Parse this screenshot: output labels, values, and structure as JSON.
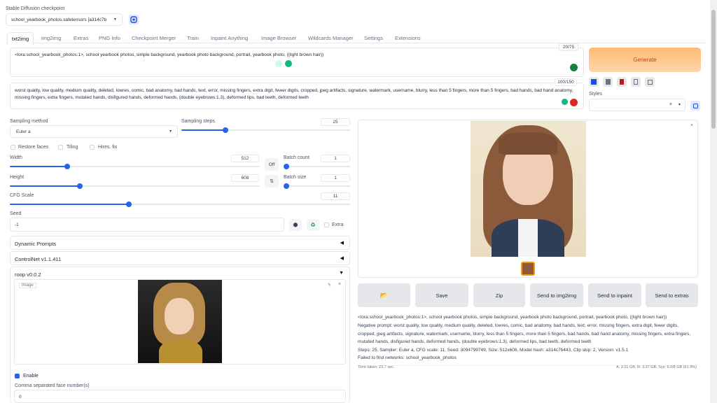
{
  "checkpoint": {
    "label": "Stable Diffusion checkpoint",
    "value": "school_yearbook_photos.safetensors [a314c7b"
  },
  "tabs": [
    "txt2img",
    "img2img",
    "Extras",
    "PNG Info",
    "Checkpoint Merger",
    "Train",
    "Inpaint Anything",
    "Image Browser",
    "Wildcards Manager",
    "Settings",
    "Extensions"
  ],
  "prompt": {
    "text": "<lora:school_yearbook_photos:1>, school yearbook photos, simple background, yearbook photo background, portrait, yearbook photo, ((light brown hair))",
    "counter": "20/75"
  },
  "negative": {
    "text": "worst quality, low quality, medium quality, deleted, lowres, comic, bad anatomy, bad hands, text, error, missing fingers, extra digit, fewer digits, cropped, jpeg artifacts, signature, watermark, username, blurry, less than 5 fingers, more than 5 fingers, bad hands, bad hand anatomy, missing fingers, extra fingers, mutated hands, disfigured hands, deformed hands, (double eyebrows:1.3), deformed lips, bad teeth, deformed teeth",
    "counter": "100/150"
  },
  "generate_label": "Generate",
  "styles_label": "Styles",
  "sampling_method": {
    "label": "Sampling method",
    "value": "Euler a"
  },
  "sampling_steps": {
    "label": "Sampling steps",
    "value": "25",
    "fraction": 0.26
  },
  "checkboxes": {
    "restore_faces": "Restore faces",
    "tiling": "Tiling",
    "hires": "Hires. fix"
  },
  "width": {
    "label": "Width",
    "value": "512",
    "fraction": 0.23
  },
  "height": {
    "label": "Height",
    "value": "608",
    "fraction": 0.28
  },
  "off_label": "Off",
  "batch_count": {
    "label": "Batch count",
    "value": "1"
  },
  "batch_size": {
    "label": "Batch size",
    "value": "1"
  },
  "cfg": {
    "label": "CFG Scale",
    "value": "11",
    "fraction": 0.35
  },
  "seed": {
    "label": "Seed",
    "value": "-1",
    "extra": "Extra"
  },
  "accordions": {
    "dynamic": "Dynamic Prompts",
    "controlnet": "ControlNet v1.1.411",
    "roop": "roop v0.0.2"
  },
  "image_label": "Image",
  "enable_label": "Enable",
  "face_numbers": {
    "label": "Comma separated face number(s)",
    "value": "0"
  },
  "actions": {
    "folder": "📂",
    "save": "Save",
    "zip": "Zip",
    "img2img": "Send to img2img",
    "inpaint": "Send to inpaint",
    "extras": "Send to extras"
  },
  "info": {
    "line1": "<lora:school_yearbook_photos:1>, school yearbook photos, simple background, yearbook photo background, portrait, yearbook photo, ((light brown hair))",
    "line2": "Negative prompt: worst quality, low quality, medium quality, deleted, lowres, comic, bad anatomy, bad hands, text, error, missing fingers, extra digit, fewer digits, cropped, jpeg artifacts, signature, watermark, username, blurry, less than 5 fingers, more than 5 fingers, bad hands, bad hand anatomy, missing fingers, extra fingers, mutated hands, disfigured hands, deformed hands, (double eyebrows:1.3), deformed lips, bad teeth, deformed teeth",
    "line3": "Steps: 25, Sampler: Euler a, CFG scale: 11, Seed: 3094799749, Size: 512x608, Model hash: a314c7b443, Clip skip: 2, Version: v1.5.1",
    "failed": "Failed to find networks: school_yearbook_photos",
    "time": "Time taken: 23.7 sec.",
    "mem": "A: 3.01 GB, R: 3.37 GB, Sys: 5.0/8 GB (61.9%)"
  },
  "colors": {
    "accent": "#2563eb",
    "generate_from": "#fdba74",
    "generate_to": "#fed7aa",
    "generate_text": "#ea580c"
  }
}
